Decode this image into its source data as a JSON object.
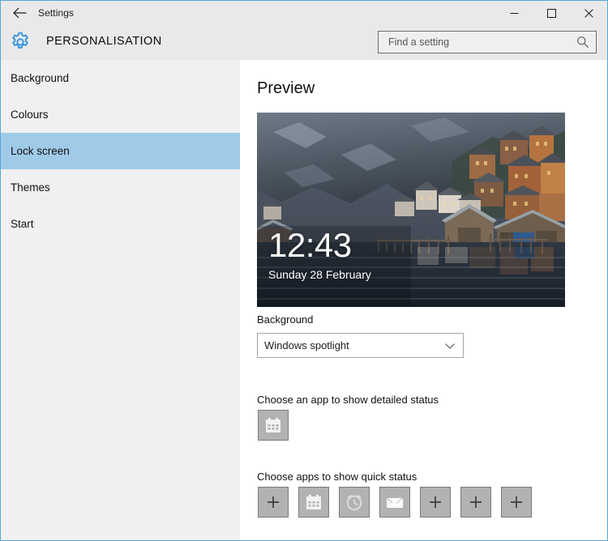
{
  "window": {
    "titlebar_title": "Settings",
    "back_icon": "back-arrow-icon",
    "minimize_icon": "minimize-icon",
    "maximize_icon": "maximize-icon",
    "close_icon": "close-icon",
    "border_color": "#5ba6d8"
  },
  "header": {
    "app_icon": "gear-icon",
    "app_icon_color": "#3a96dd",
    "title": "PERSONALISATION",
    "background_color": "#e9e9e9"
  },
  "search": {
    "placeholder": "Find a setting",
    "value": "",
    "icon": "search-icon"
  },
  "sidebar": {
    "background_color": "#f0f0f0",
    "selected_color": "#9fcae8",
    "items": [
      {
        "label": "Background",
        "name": "sidebar-item-background",
        "selected": false
      },
      {
        "label": "Colours",
        "name": "sidebar-item-colours",
        "selected": false
      },
      {
        "label": "Lock screen",
        "name": "sidebar-item-lock-screen",
        "selected": true
      },
      {
        "label": "Themes",
        "name": "sidebar-item-themes",
        "selected": false
      },
      {
        "label": "Start",
        "name": "sidebar-item-start",
        "selected": false
      }
    ]
  },
  "main": {
    "heading": "Preview",
    "preview": {
      "time": "12:43",
      "date": "Sunday 28 February",
      "description": "lock-screen-preview-image"
    },
    "background_section": {
      "label": "Background",
      "selected_option": "Windows spotlight",
      "chevron_icon": "chevron-down-icon"
    },
    "detailed_status": {
      "label": "Choose an app to show detailed status",
      "tiles": [
        {
          "icon": "calendar-icon",
          "name": "detailed-status-tile-calendar"
        }
      ]
    },
    "quick_status": {
      "label": "Choose apps to show quick status",
      "tiles": [
        {
          "icon": "plus-icon",
          "name": "quick-status-tile-1-add"
        },
        {
          "icon": "calendar-icon",
          "name": "quick-status-tile-2-calendar"
        },
        {
          "icon": "alarm-clock-icon",
          "name": "quick-status-tile-3-alarm"
        },
        {
          "icon": "mail-icon",
          "name": "quick-status-tile-4-mail"
        },
        {
          "icon": "plus-icon",
          "name": "quick-status-tile-5-add"
        },
        {
          "icon": "plus-icon",
          "name": "quick-status-tile-6-add"
        },
        {
          "icon": "plus-icon",
          "name": "quick-status-tile-7-add"
        }
      ]
    }
  }
}
